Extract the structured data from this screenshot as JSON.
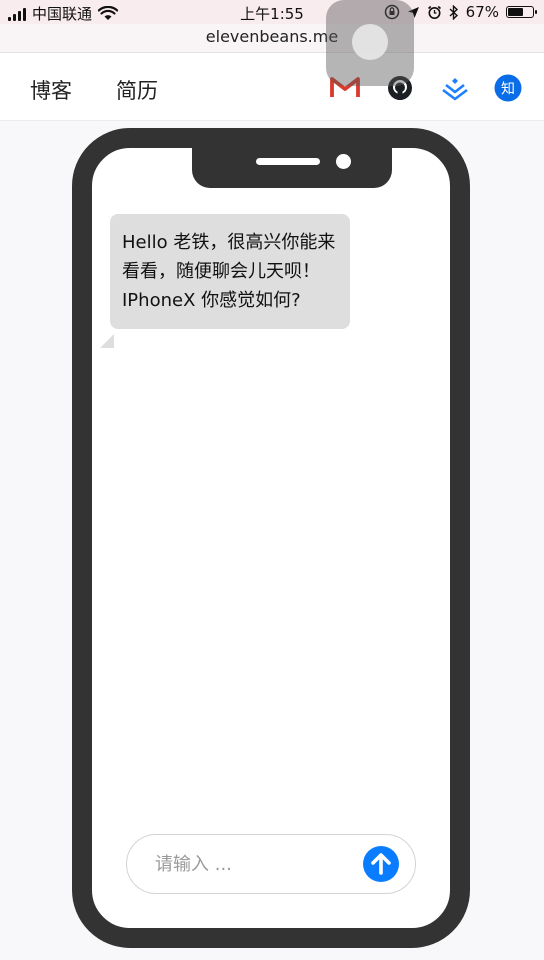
{
  "status_bar": {
    "carrier": "中国联通",
    "time": "上午1:55",
    "battery": "67%",
    "battery_level": 0.67
  },
  "browser": {
    "url": "elevenbeans.me"
  },
  "nav": {
    "links": [
      {
        "label": "博客"
      },
      {
        "label": "简历"
      }
    ],
    "icons": [
      "gmail-icon",
      "github-icon",
      "juejin-icon",
      "zhihu-icon"
    ],
    "zhihu_label": "知",
    "colors": {
      "gmail": "#d93a2b",
      "github": "#1b1f23",
      "juejin": "#1e80ff",
      "zhihu": "#0a6ce6"
    }
  },
  "chat": {
    "message": "Hello 老铁，很高兴你能来看看，随便聊会儿天呗！IPhoneX 你感觉如何?",
    "input_placeholder": "请输入 ...",
    "send_color": "#0a7cff"
  }
}
